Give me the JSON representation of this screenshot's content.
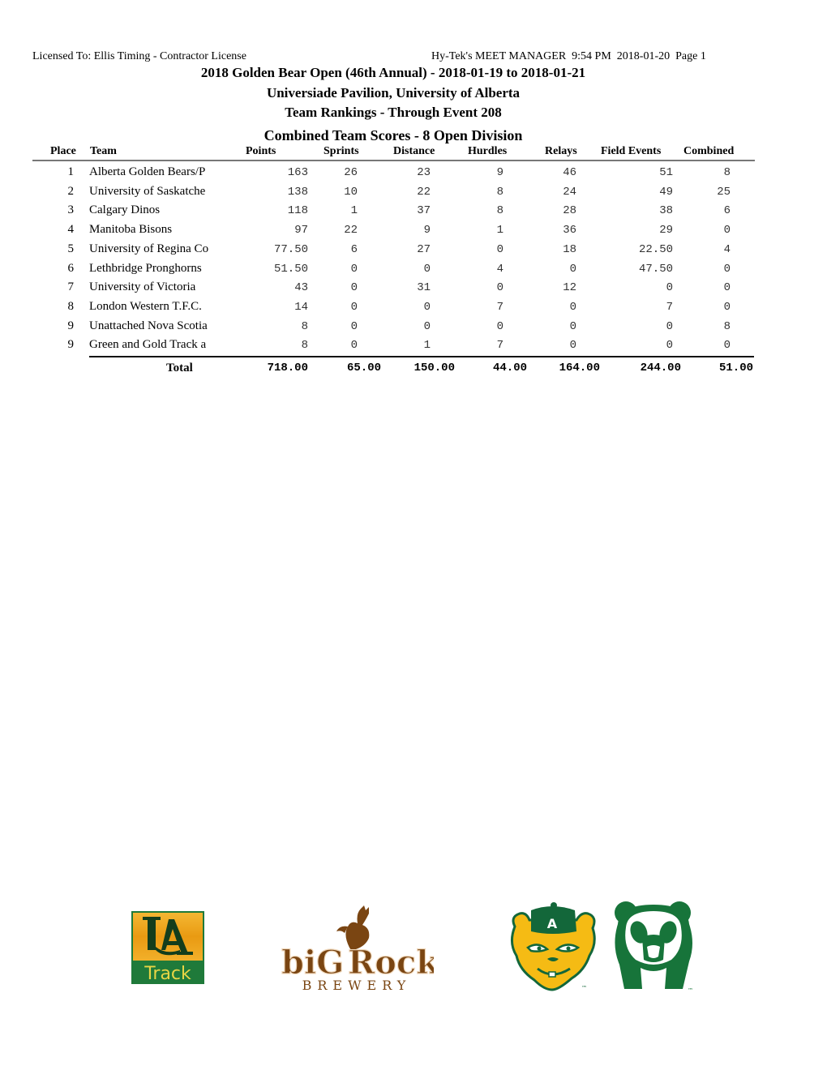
{
  "header": {
    "license": "Licensed To:  Ellis Timing - Contractor License",
    "software": "Hy-Tek's MEET MANAGER  9:54 PM  2018-01-20  Page 1"
  },
  "titles": {
    "meet": "2018 Golden Bear Open (46th Annual) - 2018-01-19 to 2018-01-21",
    "venue": "Universiade Pavilion, University of Alberta",
    "report": "Team Rankings - Through Event 208",
    "section": "Combined Team Scores -  8 Open Division"
  },
  "table": {
    "columns": {
      "place": "Place",
      "team": "Team",
      "points": "Points",
      "sprints": "Sprints",
      "distance": "Distance",
      "hurdles": "Hurdles",
      "relays": "Relays",
      "field": "Field Events",
      "combined": "Combined"
    },
    "rows": [
      {
        "place": "1",
        "team": "Alberta Golden Bears/P",
        "points": "163",
        "sprints": "26",
        "distance": "23",
        "hurdles": "9",
        "relays": "46",
        "field": "51",
        "combined": "8"
      },
      {
        "place": "2",
        "team": "University of Saskatche",
        "points": "138",
        "sprints": "10",
        "distance": "22",
        "hurdles": "8",
        "relays": "24",
        "field": "49",
        "combined": "25"
      },
      {
        "place": "3",
        "team": "Calgary Dinos",
        "points": "118",
        "sprints": "1",
        "distance": "37",
        "hurdles": "8",
        "relays": "28",
        "field": "38",
        "combined": "6"
      },
      {
        "place": "4",
        "team": "Manitoba Bisons",
        "points": "97",
        "sprints": "22",
        "distance": "9",
        "hurdles": "1",
        "relays": "36",
        "field": "29",
        "combined": "0"
      },
      {
        "place": "5",
        "team": "University of Regina Co",
        "points": "77.50",
        "sprints": "6",
        "distance": "27",
        "hurdles": "0",
        "relays": "18",
        "field": "22.50",
        "combined": "4"
      },
      {
        "place": "6",
        "team": "Lethbridge Pronghorns",
        "points": "51.50",
        "sprints": "0",
        "distance": "0",
        "hurdles": "4",
        "relays": "0",
        "field": "47.50",
        "combined": "0"
      },
      {
        "place": "7",
        "team": "University of Victoria",
        "points": "43",
        "sprints": "0",
        "distance": "31",
        "hurdles": "0",
        "relays": "12",
        "field": "0",
        "combined": "0"
      },
      {
        "place": "8",
        "team": "London Western T.F.C.",
        "points": "14",
        "sprints": "0",
        "distance": "0",
        "hurdles": "7",
        "relays": "0",
        "field": "7",
        "combined": "0"
      },
      {
        "place": "9",
        "team": "Unattached Nova Scotia",
        "points": "8",
        "sprints": "0",
        "distance": "0",
        "hurdles": "0",
        "relays": "0",
        "field": "0",
        "combined": "8"
      },
      {
        "place": "9",
        "team": "Green and Gold Track a",
        "points": "8",
        "sprints": "0",
        "distance": "1",
        "hurdles": "7",
        "relays": "0",
        "field": "0",
        "combined": "0"
      }
    ],
    "total": {
      "label": "Total",
      "points": "718.00",
      "sprints": "65.00",
      "distance": "150.00",
      "hurdles": "44.00",
      "relays": "164.00",
      "field": "244.00",
      "combined": "51.00"
    }
  },
  "logos": {
    "ua_track": {
      "monogram": "UA",
      "label": "Track",
      "bg": "#f0a91c",
      "band": "#1f7a3a",
      "text": "#e8d545"
    },
    "big_rock": {
      "word1": "biG",
      "word2": "Rock",
      "sub": "BREWERY",
      "color": "#7a4512"
    },
    "golden_bears": {
      "letter": "A",
      "tm": "™",
      "gold": "#f5bb14",
      "green": "#13673a"
    },
    "pandas": {
      "tm": "™",
      "green": "#17743a"
    }
  },
  "colors": {
    "rule_header": "#777777",
    "rule_total": "#111111"
  }
}
